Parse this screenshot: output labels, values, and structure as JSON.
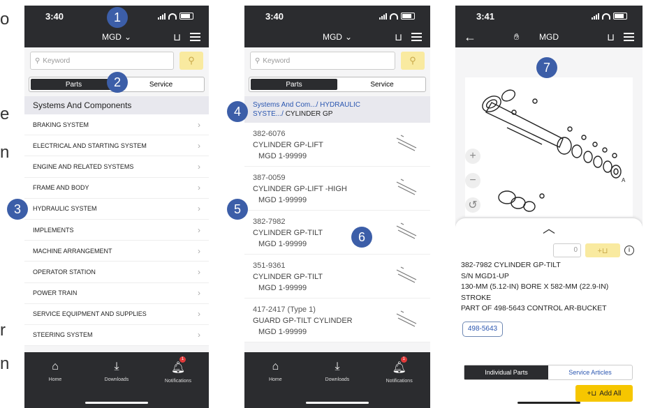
{
  "edge_fragments": [
    "o",
    "e",
    "n",
    "r",
    "n"
  ],
  "status_bar": {
    "time1": "3:40",
    "time2": "3:40",
    "time3": "3:41"
  },
  "header": {
    "model": "MGD"
  },
  "search": {
    "placeholder": "Keyword"
  },
  "toggle": {
    "parts": "Parts",
    "service": "Service"
  },
  "screen1": {
    "section_title": "Systems And Components",
    "items": [
      "BRAKING SYSTEM",
      "ELECTRICAL AND STARTING SYSTEM",
      "ENGINE AND RELATED SYSTEMS",
      "FRAME AND BODY",
      "HYDRAULIC SYSTEM",
      "IMPLEMENTS",
      "MACHINE ARRANGEMENT",
      "OPERATOR STATION",
      "POWER TRAIN",
      "SERVICE EQUIPMENT AND SUPPLIES",
      "STEERING SYSTEM"
    ]
  },
  "screen2": {
    "breadcrumb_link1": "Systems And Com.../",
    "breadcrumb_link2": "HYDRAULIC",
    "breadcrumb_link3": "SYSTE.../",
    "breadcrumb_current": "CYLINDER GP",
    "parts": [
      {
        "number": "382-6076",
        "name": "CYLINDER GP-LIFT",
        "range": "MGD 1-99999"
      },
      {
        "number": "387-0059",
        "name": "CYLINDER GP-LIFT -HIGH",
        "range": "MGD 1-99999"
      },
      {
        "number": "382-7982",
        "name": "CYLINDER GP-TILT",
        "range": "MGD 1-99999"
      },
      {
        "number": "351-9361",
        "name": "CYLINDER GP-TILT",
        "range": "MGD 1-99999"
      },
      {
        "number": "417-2417 (Type 1)",
        "name": "GUARD GP-TILT CYLINDER",
        "range": "MGD 1-99999"
      }
    ]
  },
  "screen3": {
    "qty": "0",
    "desc_lines": [
      "382-7982 CYLINDER GP-TILT",
      "S/N MGD1-UP",
      "130-MM (5.12-IN) BORE X 582-MM (22.9-IN)",
      "STROKE",
      "PART OF 498-5643 CONTROL AR-BUCKET"
    ],
    "link_tag": "498-5643",
    "tab_individual": "Individual Parts",
    "tab_service": "Service Articles",
    "add_all": "Add All",
    "diagram_label": "A"
  },
  "tabbar": {
    "home": "Home",
    "downloads": "Downloads",
    "notifications": "Notifications",
    "notif_count": "1"
  },
  "badges": [
    "1",
    "2",
    "3",
    "4",
    "5",
    "6",
    "7"
  ],
  "colors": {
    "dark": "#2b2c2f",
    "accent_yellow": "#f6c600",
    "link_blue": "#2a56b0",
    "badge_blue": "#3c5ea8"
  }
}
